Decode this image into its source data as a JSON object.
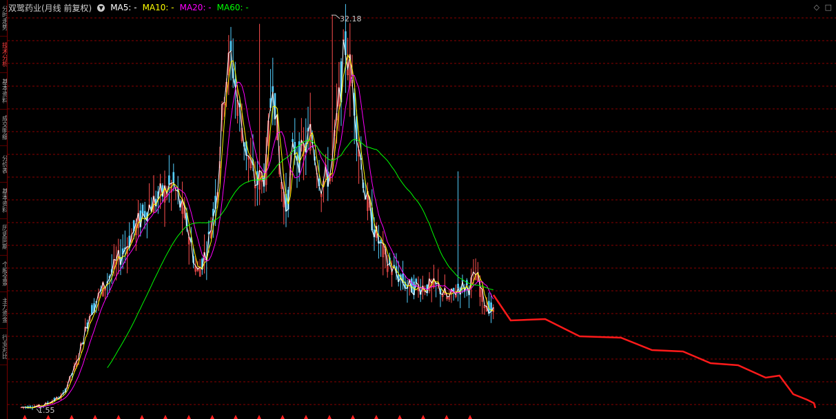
{
  "header": {
    "title": "双鹭药业(月线 前复权)",
    "ma5_label": "MA5: -",
    "ma10_label": "MA10: -",
    "ma20_label": "MA20: -",
    "ma60_label": "MA60: -",
    "ma5_color": "#ffffff",
    "ma10_color": "#ffff00",
    "ma20_color": "#ff00ff",
    "ma60_color": "#00ff00"
  },
  "sidebar": {
    "items": [
      {
        "label": "分时走势"
      },
      {
        "label": "技术分析",
        "active": true
      },
      {
        "label": "基本资料"
      },
      {
        "label": "成交明细"
      },
      {
        "label": "分价表"
      },
      {
        "label": "基本资料"
      },
      {
        "label": "历史同期"
      },
      {
        "label": "个股全景"
      },
      {
        "label": "主力资金"
      },
      {
        "label": "行业对比"
      }
    ]
  },
  "markers": {
    "high": "32.18",
    "low": "1.55"
  },
  "right_icons": [
    "diamond-icon",
    "square-icon"
  ],
  "colors": {
    "up": "#ff5050",
    "down": "#54d0ff",
    "grid": "#8b0000",
    "projection": "#ff1a1a",
    "background": "#000000"
  },
  "chart_data": {
    "type": "candlestick",
    "high_price": 32.18,
    "low_price": 1.55,
    "ma_lines": [
      "MA5",
      "MA10",
      "MA20",
      "MA60"
    ],
    "grid": true
  }
}
